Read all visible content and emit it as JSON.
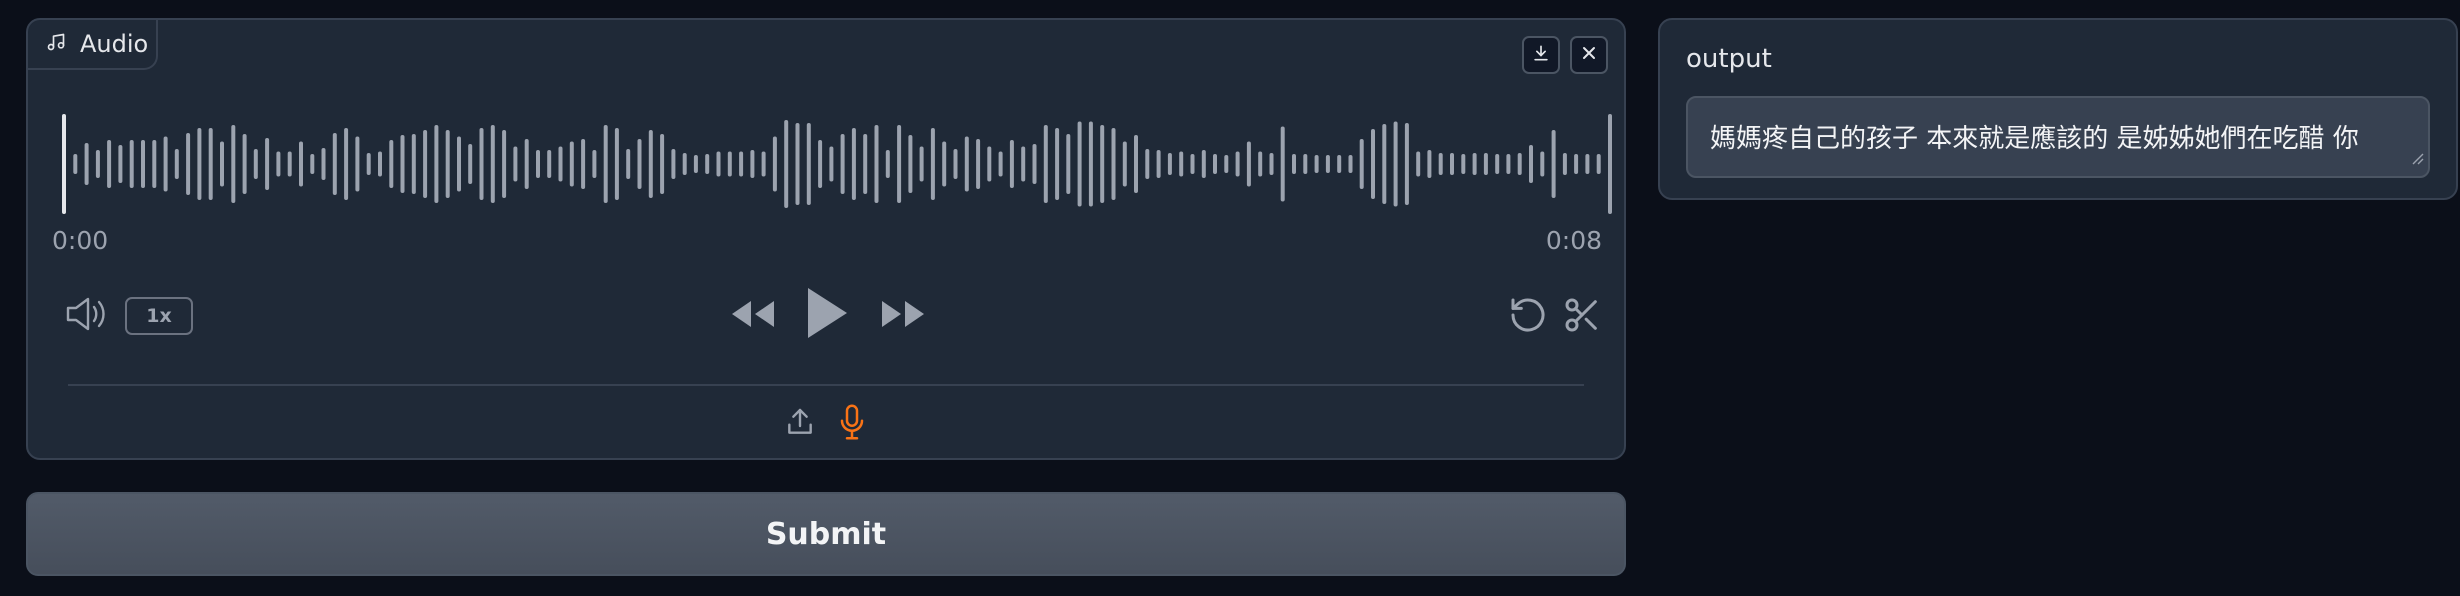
{
  "audio": {
    "label": "Audio",
    "time_start": "0:00",
    "time_end": "0:08",
    "speed": "1x",
    "waveform_levels": [
      1.0,
      0.2,
      0.42,
      0.28,
      0.48,
      0.38,
      0.48,
      0.48,
      0.48,
      0.55,
      0.3,
      0.62,
      0.72,
      0.72,
      0.45,
      0.78,
      0.6,
      0.3,
      0.52,
      0.25,
      0.25,
      0.45,
      0.2,
      0.32,
      0.62,
      0.72,
      0.55,
      0.22,
      0.25,
      0.48,
      0.58,
      0.6,
      0.68,
      0.78,
      0.68,
      0.55,
      0.4,
      0.72,
      0.78,
      0.68,
      0.35,
      0.5,
      0.28,
      0.28,
      0.35,
      0.45,
      0.5,
      0.28,
      0.78,
      0.72,
      0.3,
      0.5,
      0.68,
      0.6,
      0.3,
      0.22,
      0.18,
      0.2,
      0.25,
      0.25,
      0.25,
      0.28,
      0.25,
      0.55,
      0.88,
      0.82,
      0.82,
      0.48,
      0.35,
      0.6,
      0.72,
      0.6,
      0.78,
      0.28,
      0.78,
      0.58,
      0.35,
      0.72,
      0.45,
      0.3,
      0.55,
      0.5,
      0.35,
      0.25,
      0.48,
      0.35,
      0.4,
      0.78,
      0.72,
      0.6,
      0.85,
      0.85,
      0.78,
      0.72,
      0.45,
      0.58,
      0.3,
      0.28,
      0.22,
      0.25,
      0.2,
      0.28,
      0.2,
      0.18,
      0.25,
      0.45,
      0.25,
      0.22,
      0.75,
      0.2,
      0.2,
      0.18,
      0.18,
      0.18,
      0.18,
      0.5,
      0.7,
      0.8,
      0.85,
      0.82,
      0.25,
      0.28,
      0.22,
      0.22,
      0.2,
      0.22,
      0.22,
      0.2,
      0.2,
      0.22,
      0.38,
      0.25,
      0.68,
      0.22,
      0.2,
      0.2,
      0.2,
      1.0
    ]
  },
  "actions": {
    "submit_label": "Submit"
  },
  "output": {
    "label": "output",
    "value": "媽媽疼自己的孩子 本來就是應該的 是姊姊她們在吃醋 你"
  },
  "colors": {
    "mic_accent": "#f97316",
    "waveform": "#9ca3af"
  }
}
